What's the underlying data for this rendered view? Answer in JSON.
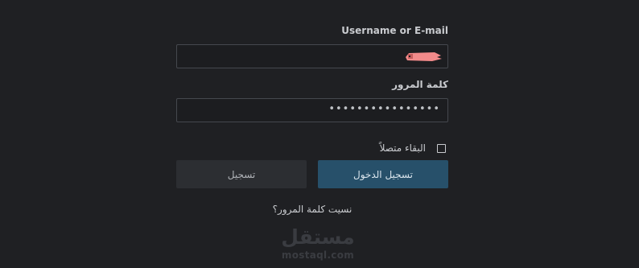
{
  "login_form": {
    "username_label": "Username or E-mail",
    "password_label": "كلمة المرور",
    "password_value": "••••••••••••••••",
    "remember_label": "البقاء متصلاً",
    "login_button": "تسجيل الدخول",
    "register_button": "تسجيل",
    "forgot_link": "نسيت كلمة المرور؟"
  },
  "branding": {
    "logo_text": "mostaql.com",
    "logo_mark": "مستقل"
  },
  "colors": {
    "background": "#1f2023",
    "primary_button": "#27506a",
    "secondary_button": "#2c2e32",
    "redaction": "#f28a8a"
  }
}
